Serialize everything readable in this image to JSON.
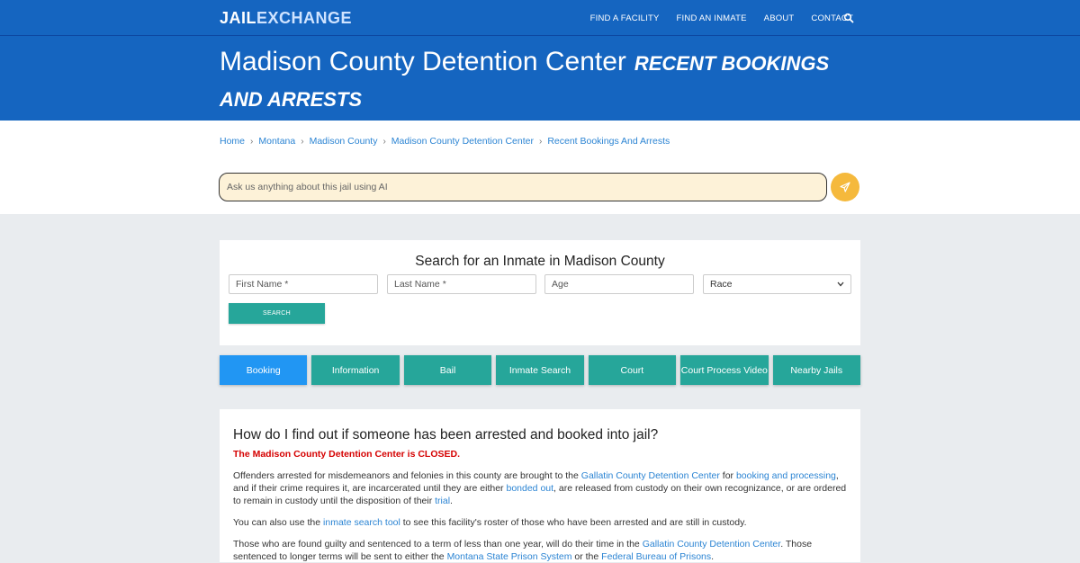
{
  "header": {
    "logo_part1": "JAIL",
    "logo_part2": "EXCHANGE",
    "nav": [
      "FIND A FACILITY",
      "FIND AN INMATE",
      "ABOUT",
      "CONTACT"
    ]
  },
  "hero": {
    "title": "Madison County Detention Center",
    "subtitle": "RECENT BOOKINGS AND ARRESTS"
  },
  "breadcrumb": [
    "Home",
    "Montana",
    "Madison County",
    "Madison County Detention Center",
    "Recent Bookings And Arrests"
  ],
  "ai_search": {
    "placeholder": "Ask us anything about this jail using AI"
  },
  "inmate_search": {
    "title": "Search for an Inmate in Madison County",
    "first_name_placeholder": "First Name *",
    "last_name_placeholder": "Last Name *",
    "age_placeholder": "Age",
    "race_value": "Race",
    "button_label": "SEARCH"
  },
  "tabs": [
    "Booking",
    "Information",
    "Bail",
    "Inmate Search",
    "Court",
    "Court Process Video",
    "Nearby Jails"
  ],
  "article": {
    "heading": "How do I find out if someone has been arrested and booked into jail?",
    "closed_notice": "The Madison County Detention Center is CLOSED.",
    "p1": {
      "t1": "Offenders arrested for misdemeanors and felonies in this county are brought to the ",
      "link1": "Gallatin County Detention Center",
      "t2": " for ",
      "link2": "booking and processing",
      "t3": ", and if their crime requires it, are incarcerated until they are either ",
      "link3": "bonded out",
      "t4": ", are released from custody on their own recognizance, or are ordered to remain in custody until the disposition of their ",
      "link4": "trial",
      "t5": "."
    },
    "p2": {
      "t1": "You can also use the ",
      "link1": "inmate search tool",
      "t2": " to see this facility's roster of those who have been arrested and are still in custody."
    },
    "p3": {
      "t1": "Those who are found guilty and sentenced to a term of less than one year, will do their time in the ",
      "link1": "Gallatin County Detention Center",
      "t2": ". Those sentenced to longer terms will be sent to either the ",
      "link2": "Montana State Prison System",
      "t3": " or the ",
      "link3": "Federal Bureau of Prisons",
      "t4": "."
    }
  },
  "colors": {
    "brand_blue": "#1565c0",
    "teal": "#26a69a",
    "active_tab": "#2196f3",
    "ai_button": "#f5b93c",
    "closed_red": "#d50000"
  }
}
